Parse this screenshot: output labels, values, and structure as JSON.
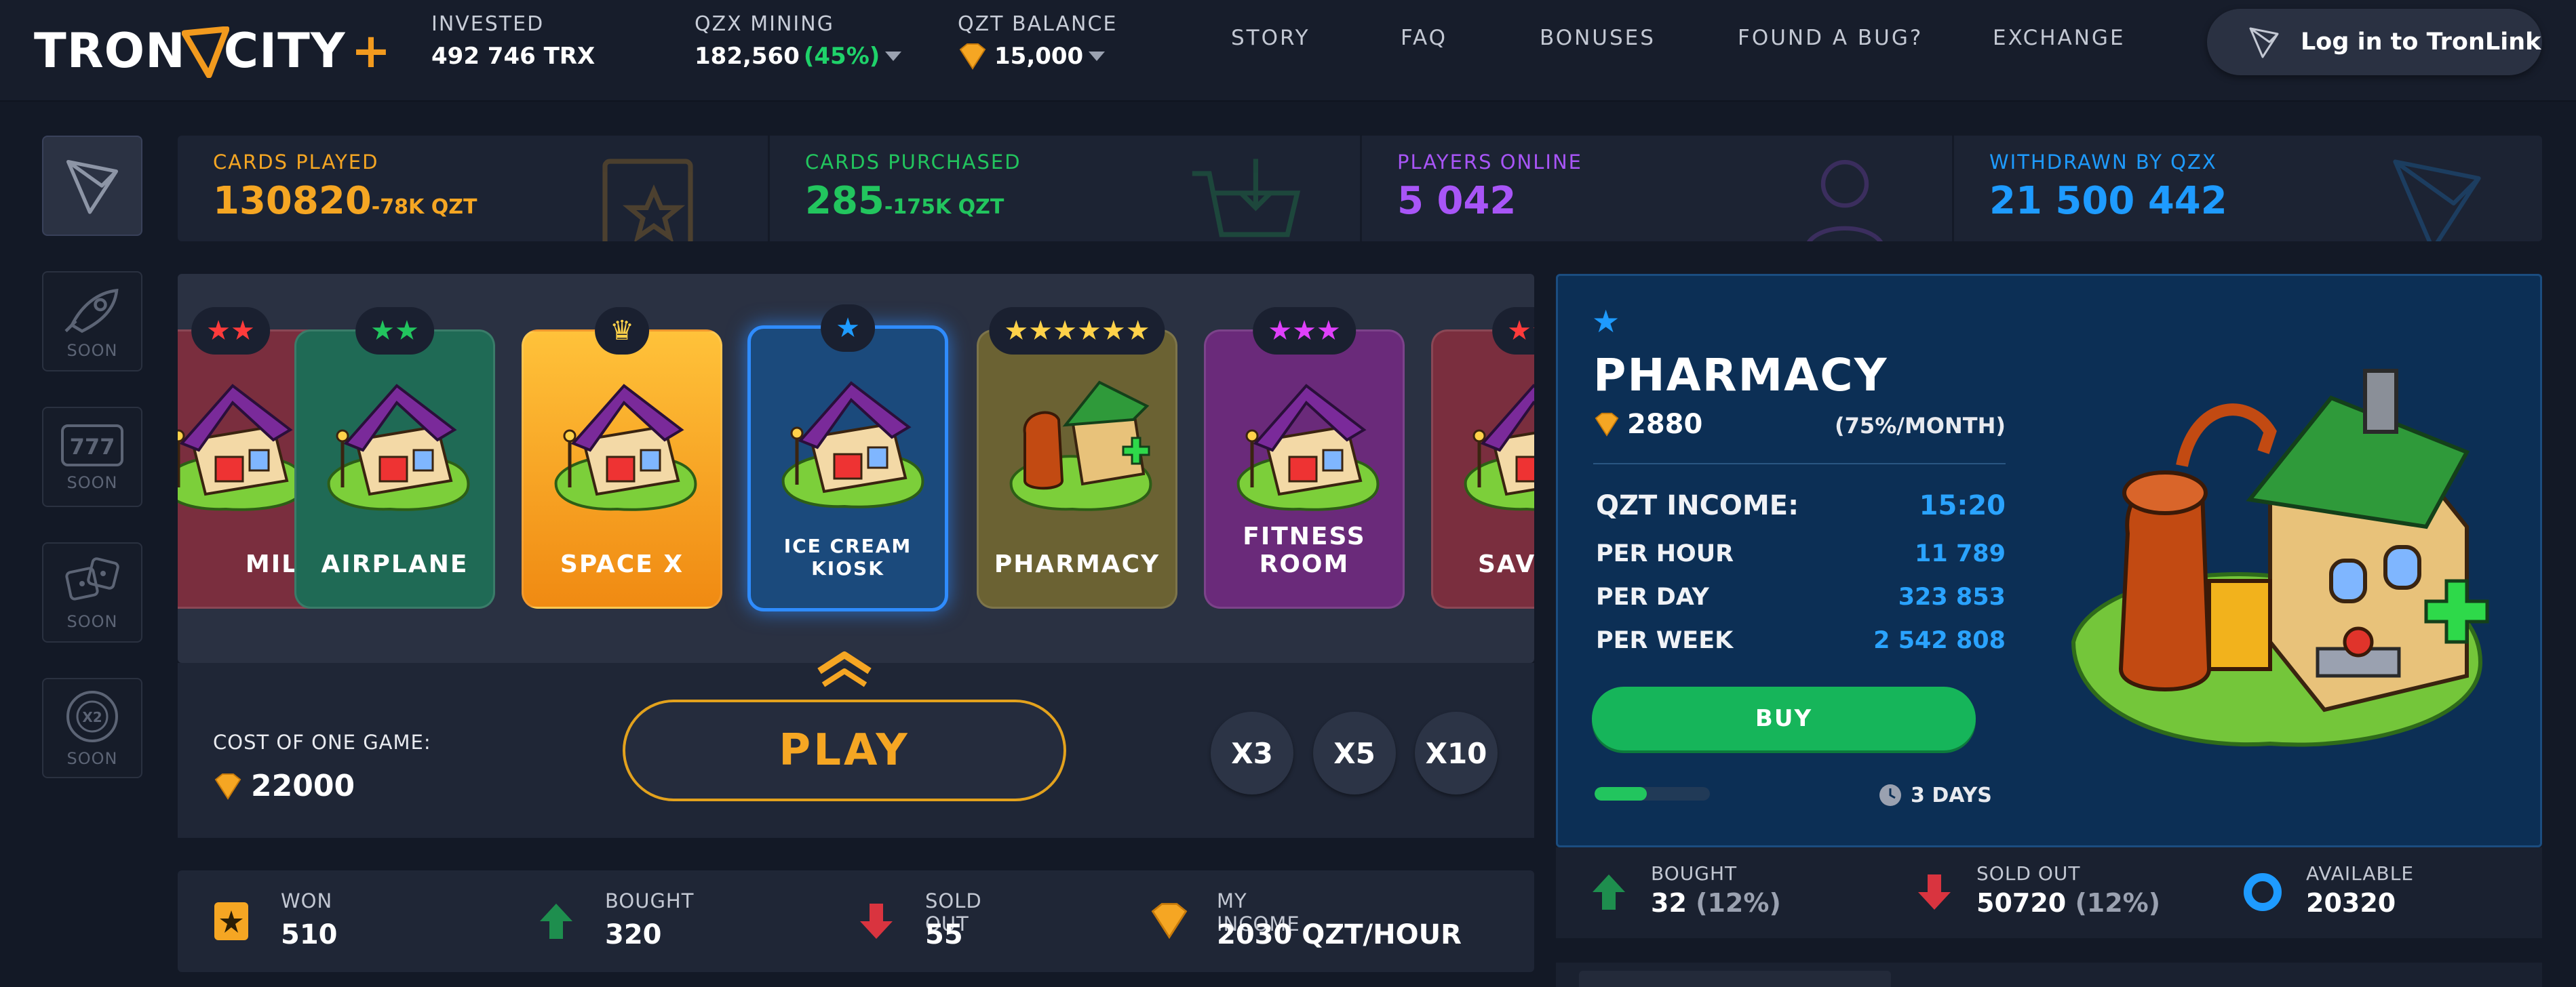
{
  "header": {
    "logo_part1": "TRON",
    "logo_part2": "CITY",
    "logo_plus": "+",
    "invested_label": "INVESTED",
    "invested_value": "492 746 TRX",
    "mining_label": "QZX MINING",
    "mining_value": "182,560",
    "mining_pct": "(45%)",
    "balance_label": "QZT BALANCE",
    "balance_value": "15,000",
    "nav": [
      "STORY",
      "FAQ",
      "BONUSES",
      "FOUND A BUG?",
      "EXCHANGE"
    ],
    "login_label": "Log in to TronLink"
  },
  "sidebar": {
    "soon_label": "SOON",
    "items": [
      "tron-icon",
      "rocket-icon",
      "slot-777-icon",
      "dice-icon",
      "roulette-x2-icon"
    ]
  },
  "stats": [
    {
      "label": "CARDS PLAYED",
      "value": "130820",
      "sub": "-78K QZT",
      "color": "#f5a623"
    },
    {
      "label": "CARDS PURCHASED",
      "value": "285",
      "sub": "-175K QZT",
      "color": "#22c55e"
    },
    {
      "label": "PLAYERS ONLINE",
      "value": "5 042",
      "sub": "",
      "color": "#a855f7"
    },
    {
      "label": "WITHDRAWN BY QZX",
      "value": "21 500 442",
      "sub": "",
      "color": "#1e9bff"
    }
  ],
  "cards": [
    {
      "name": "MILL",
      "stars": "★★",
      "star_color": "#ff3b3b",
      "bg": "#7a2e3e"
    },
    {
      "name": "AIRPLANE",
      "stars": "★★",
      "star_color": "#22c55e",
      "bg": "#1f6a55"
    },
    {
      "name": "SPACE X",
      "stars": "♛",
      "star_color": "#ffd24a",
      "bg": "#f5a623"
    },
    {
      "name": "ICE CREAM KIOSK",
      "stars": "★",
      "star_color": "#1e9bff",
      "bg": "#1b4a7c"
    },
    {
      "name": "PHARMACY",
      "stars": "★★★★★★",
      "star_color": "#ffd24a",
      "bg": "#6b6233"
    },
    {
      "name": "FITNESS ROOM",
      "stars": "★★★",
      "star_color": "#e040fb",
      "bg": "#6a2a7a"
    },
    {
      "name": "SAV",
      "stars": "★★",
      "star_color": "#ff3b3b",
      "bg": "#7a2e3e"
    }
  ],
  "controls": {
    "cost_label": "COST OF ONE GAME:",
    "cost_value": "22000",
    "play_label": "PLAY",
    "multipliers": [
      "X3",
      "X5",
      "X10"
    ]
  },
  "bottom_stats": [
    {
      "label": "WON",
      "value": "510"
    },
    {
      "label": "BOUGHT",
      "value": "320"
    },
    {
      "label": "SOLD OUT",
      "value": "55"
    },
    {
      "label": "MY INCOME",
      "value": "2030 QZT/HOUR"
    }
  ],
  "detail": {
    "title": "PHARMACY",
    "price": "2880",
    "pct": "(75%/MONTH)",
    "income_label": "QZT INCOME:",
    "income_value": "15:20",
    "rows": [
      {
        "label": "PER HOUR",
        "value": "11 789"
      },
      {
        "label": "PER DAY",
        "value": "323 853"
      },
      {
        "label": "PER WEEK",
        "value": "2 542 808"
      }
    ],
    "buy_label": "BUY",
    "progress": 0.45,
    "days_label": "3 DAYS"
  },
  "detail_stats": [
    {
      "label": "BOUGHT",
      "value": "32",
      "pct": "(12%)"
    },
    {
      "label": "SOLD OUT",
      "value": "50720",
      "pct": "(12%)"
    },
    {
      "label": "AVAILABLE",
      "value": "20320",
      "pct": ""
    }
  ],
  "colors": {
    "accent_orange": "#f5a623",
    "green": "#22c55e",
    "purple": "#a855f7",
    "blue": "#1e9bff",
    "bg": "#131926"
  }
}
